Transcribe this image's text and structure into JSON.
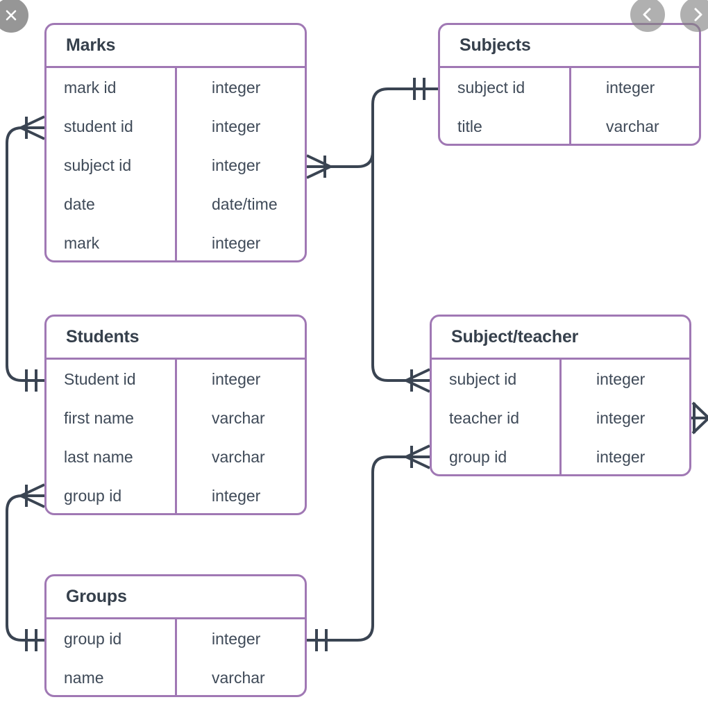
{
  "viewer": {
    "close_label": "Close",
    "prev_label": "Previous",
    "next_label": "Next",
    "close_icon": "close-x-icon",
    "prev_icon": "chevron-left-icon",
    "next_icon": "chevron-right-icon"
  },
  "theme": {
    "entity_border": "#a078b4",
    "text": "#3f4a58",
    "title_text": "#36404c",
    "connector": "#3a4452",
    "background": "#ffffff",
    "control_bg": "rgba(128,128,128,0.62)"
  },
  "diagram": {
    "type": "entity-relationship-diagram",
    "notation": "crows-foot",
    "entities": [
      {
        "id": "marks",
        "title": "Marks",
        "attributes": [
          {
            "name": "mark id",
            "type": "integer"
          },
          {
            "name": "student id",
            "type": "integer"
          },
          {
            "name": "subject id",
            "type": "integer"
          },
          {
            "name": "date",
            "type": "date/time"
          },
          {
            "name": "mark",
            "type": "integer"
          }
        ]
      },
      {
        "id": "subjects",
        "title": "Subjects",
        "attributes": [
          {
            "name": "subject id",
            "type": "integer"
          },
          {
            "name": "title",
            "type": "varchar"
          }
        ]
      },
      {
        "id": "students",
        "title": "Students",
        "attributes": [
          {
            "name": "Student id",
            "type": "integer"
          },
          {
            "name": "first name",
            "type": "varchar"
          },
          {
            "name": "last name",
            "type": "varchar"
          },
          {
            "name": "group id",
            "type": "integer"
          }
        ]
      },
      {
        "id": "subject_teacher",
        "title": "Subject/teacher",
        "attributes": [
          {
            "name": "subject id",
            "type": "integer"
          },
          {
            "name": "teacher id",
            "type": "integer"
          },
          {
            "name": "group id",
            "type": "integer"
          }
        ]
      },
      {
        "id": "groups",
        "title": "Groups",
        "attributes": [
          {
            "name": "group id",
            "type": "integer"
          },
          {
            "name": "name",
            "type": "varchar"
          }
        ]
      }
    ],
    "relationships": [
      {
        "from": "students.Student id",
        "to": "marks.student id",
        "from_cardinality": "one",
        "to_cardinality": "many"
      },
      {
        "from": "subjects.subject id",
        "to": "marks.subject id",
        "from_cardinality": "one",
        "to_cardinality": "many"
      },
      {
        "from": "subjects.subject id",
        "to": "subject_teacher.subject id",
        "from_cardinality": "one",
        "to_cardinality": "many"
      },
      {
        "from": "groups.group id",
        "to": "students.group id",
        "from_cardinality": "one",
        "to_cardinality": "many"
      },
      {
        "from": "groups.group id",
        "to": "subject_teacher.group id",
        "from_cardinality": "one",
        "to_cardinality": "many"
      },
      {
        "from": "subject_teacher.teacher id",
        "to": "offscreen",
        "from_cardinality": "many",
        "to_cardinality": "unknown"
      }
    ]
  }
}
